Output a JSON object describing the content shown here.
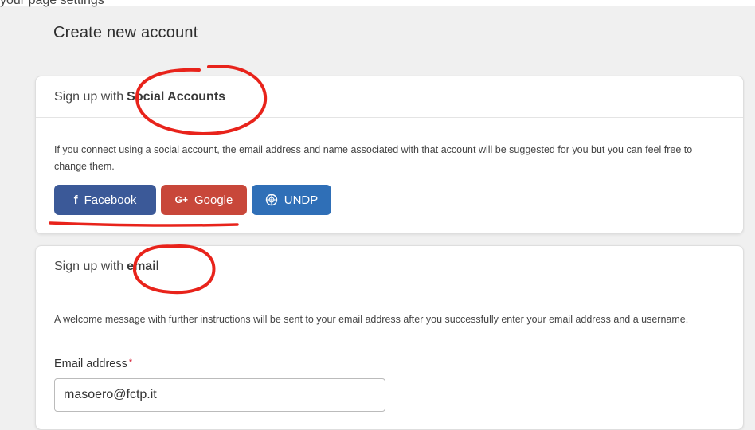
{
  "page": {
    "top_strip_text": "your page settings",
    "title": "Create new account"
  },
  "social_card": {
    "header_prefix": "Sign up with",
    "header_bold": "Social Accounts",
    "description": "If you connect using a social account, the email address and name associated with that account will be suggested for you but you can feel free to change them.",
    "buttons": {
      "facebook": {
        "label": "Facebook",
        "icon": "facebook-icon",
        "color": "#3b5998"
      },
      "google": {
        "label": "Google",
        "icon": "google-plus-icon",
        "color": "#c8473a"
      },
      "undp": {
        "label": "UNDP",
        "icon": "un-emblem-icon",
        "color": "#2f6fb7"
      }
    }
  },
  "email_card": {
    "header_prefix": "Sign up with",
    "header_bold": "email",
    "description": "A welcome message with further instructions will be sent to your email address after you successfully enter your email address and a username.",
    "email_label": "Email address",
    "required_mark": "*",
    "email_value": "masoero@fctp.it"
  },
  "annotations": {
    "color": "#e8231b"
  }
}
